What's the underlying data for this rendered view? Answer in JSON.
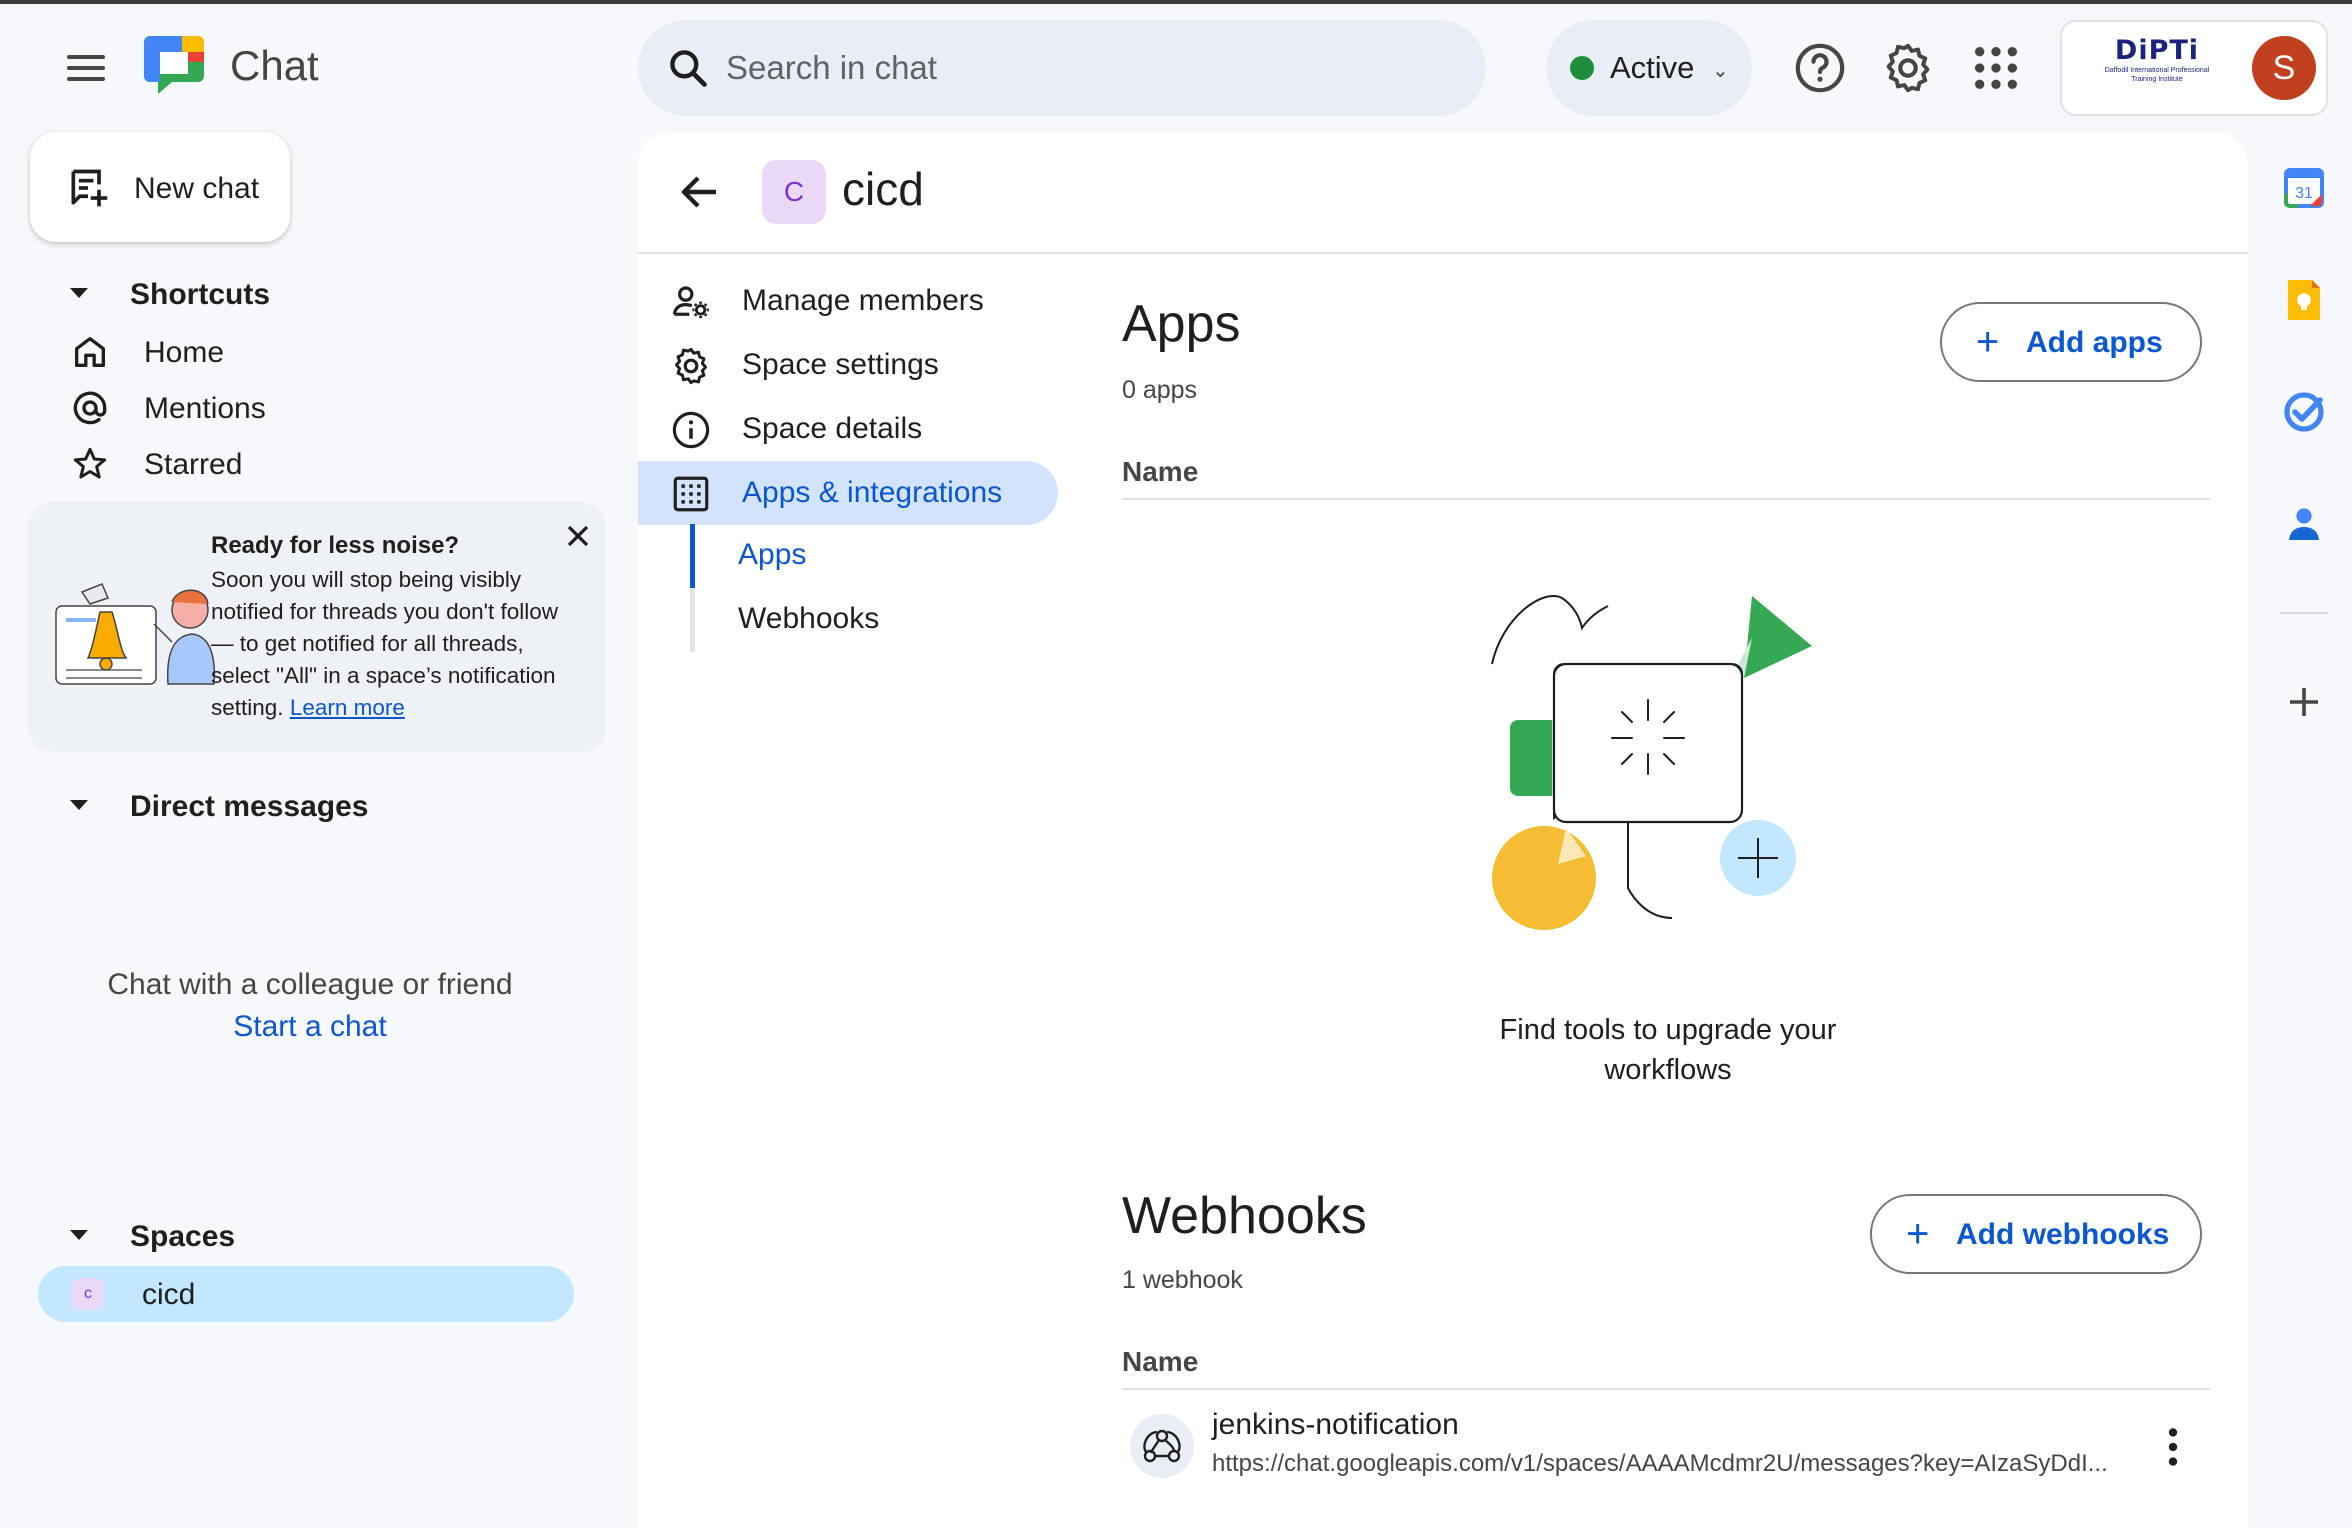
{
  "header": {
    "app_title": "Chat",
    "search_placeholder": "Search in chat",
    "status": "Active",
    "org_logo_text": "DiPTi",
    "org_logo_subtext": "Daffodil International Professional Training Institute",
    "avatar_letter": "S"
  },
  "sidebar": {
    "new_chat_label": "New chat",
    "shortcuts": {
      "title": "Shortcuts",
      "items": [
        {
          "label": "Home",
          "icon": "home-icon"
        },
        {
          "label": "Mentions",
          "icon": "at-icon"
        },
        {
          "label": "Starred",
          "icon": "star-icon"
        }
      ]
    },
    "promo": {
      "title": "Ready for less noise?",
      "body": "Soon you will stop being visibly notified for threads you don't follow — to get notified for all threads, select \"All\" in a space’s notification setting.",
      "link": "Learn more"
    },
    "direct_messages": {
      "title": "Direct messages",
      "empty_text": "Chat with a colleague or friend",
      "empty_link": "Start a chat"
    },
    "spaces": {
      "title": "Spaces",
      "items": [
        {
          "initial": "c",
          "label": "cicd"
        }
      ]
    }
  },
  "room": {
    "initial": "C",
    "title": "cicd",
    "menu": [
      {
        "label": "Manage members",
        "icon": "manage-members-icon"
      },
      {
        "label": "Space settings",
        "icon": "settings-gear-icon"
      },
      {
        "label": "Space details",
        "icon": "info-icon"
      },
      {
        "label": "Apps & integrations",
        "icon": "apps-grid-icon"
      }
    ],
    "submenu": [
      "Apps",
      "Webhooks"
    ],
    "apps": {
      "heading": "Apps",
      "count": "0 apps",
      "column": "Name",
      "add_label": "Add apps",
      "empty_caption": "Find tools to upgrade your workflows"
    },
    "webhooks": {
      "heading": "Webhooks",
      "count": "1 webhook",
      "column": "Name",
      "add_label": "Add webhooks",
      "items": [
        {
          "name": "jenkins-notification",
          "url": "https://chat.googleapis.com/v1/spaces/AAAAMcdmr2U/messages?key=AIzaSyDdI..."
        }
      ]
    }
  },
  "right_rail": {
    "icons": [
      "calendar-icon",
      "keep-icon",
      "tasks-icon",
      "contacts-icon",
      "add-icon"
    ],
    "calendar_day": "31"
  },
  "colors": {
    "accent": "#0b57d0",
    "active_bg": "#d3e3fd",
    "space_selected_bg": "#c2e7ff",
    "status_green": "#1e8e3e",
    "avatar_bg": "#c0401f"
  }
}
